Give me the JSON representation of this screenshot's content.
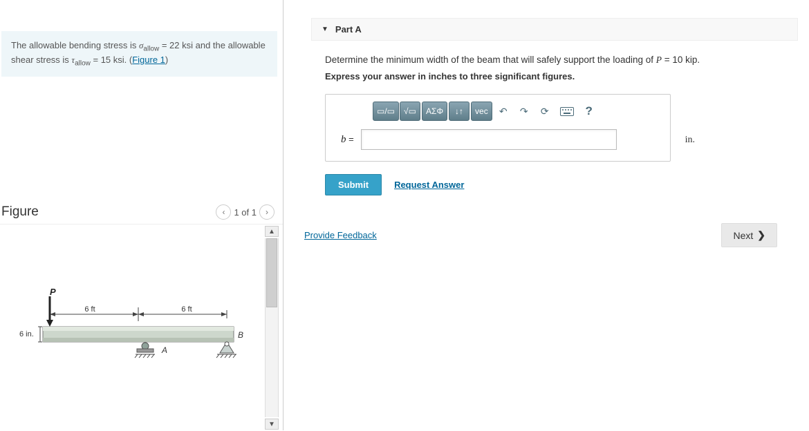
{
  "problem": {
    "intro_prefix": "The allowable bending stress is ",
    "sigma_sym": "σ",
    "sigma_sub": "allow",
    "sigma_val": " = 22 ksi",
    "intro_mid": " and the allowable shear stress is ",
    "tau_sym": "τ",
    "tau_sub": "allow",
    "tau_val": " = 15 ksi",
    "intro_end": ". (",
    "figure_link": "Figure 1",
    "intro_close": ")"
  },
  "figure": {
    "title": "Figure",
    "pager_text": "1 of 1",
    "dim_left": "6 ft",
    "dim_right": "6 ft",
    "height_label": "6 in.",
    "load_label": "P",
    "support_a": "A",
    "support_b": "B"
  },
  "part": {
    "header": "Part A",
    "prompt_prefix": "Determine the minimum width of the beam that will safely support the loading of ",
    "p_sym": "P",
    "p_val": " = 10 kip",
    "prompt_suffix": ".",
    "instruction": "Express your answer in inches to three significant figures.",
    "var_label_sym": "b",
    "var_label_eq": " =",
    "unit": "in.",
    "tb_fraction": "▭/▭",
    "tb_root": "√▭",
    "tb_greek": "ΑΣΦ",
    "tb_updown": "↓↑",
    "tb_vec": "vec",
    "tb_help": "?",
    "submit": "Submit",
    "request": "Request Answer"
  },
  "footer": {
    "feedback": "Provide Feedback",
    "next": "Next"
  }
}
